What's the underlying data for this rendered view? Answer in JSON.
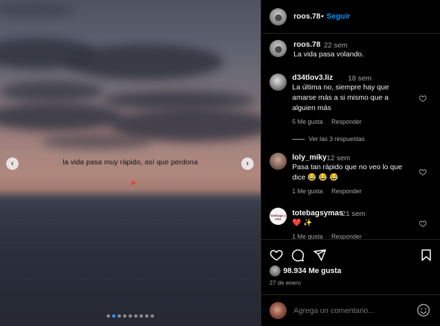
{
  "media": {
    "caption": "la vida pasa muy rápido, así que perdona",
    "nav_prev": "‹",
    "nav_next": "›",
    "carousel_count": 9,
    "carousel_active": 1
  },
  "post": {
    "username": "roos.78",
    "separator": "•",
    "follow_label": "Seguir"
  },
  "comments": [
    {
      "username": "roos.78",
      "time": "22 sem",
      "text": "La vida pasa volando.",
      "likes": "",
      "reply": ""
    },
    {
      "username": "d34tlov3.liz",
      "time": "18 sem",
      "text": "La última no, siempre hay que amarse más a si mismo que a alguien más",
      "likes": "5 Me gusta",
      "reply": "Responder",
      "view_replies": "Ver las 3 respuestas"
    },
    {
      "username": "loly_miky",
      "time": "12 sem",
      "text": "Pasa tan rápido que no veo lo que dice 😂 😂 😂",
      "likes": "1 Me gusta",
      "reply": "Responder"
    },
    {
      "username": "totebagsymas",
      "time": "21 sem",
      "text": "❤️ ✨",
      "likes": "1 Me gusta",
      "reply": "Responder",
      "avatar_text": "totebags y más"
    }
  ],
  "actions": {
    "likes_count": "98.934 Me gusta",
    "date": "27 de enero"
  },
  "add_comment": {
    "placeholder": "Agrega un comentario..."
  },
  "colors": {
    "accent": "#0095f6",
    "background": "#000000",
    "muted": "#a8a8a8",
    "text": "#f5f5f5",
    "carousel_active": "#2f8cff"
  },
  "icons": [
    "heart-icon",
    "comment-icon",
    "share-icon",
    "bookmark-icon",
    "emoji-icon",
    "chevron-left-icon",
    "chevron-right-icon"
  ]
}
